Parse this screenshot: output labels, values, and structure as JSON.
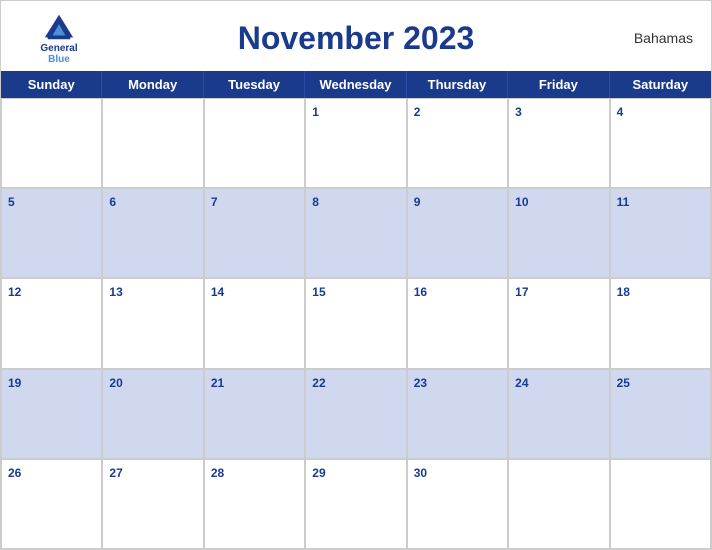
{
  "header": {
    "title": "November 2023",
    "country": "Bahamas",
    "logo_general": "General",
    "logo_blue": "Blue"
  },
  "days": [
    "Sunday",
    "Monday",
    "Tuesday",
    "Wednesday",
    "Thursday",
    "Friday",
    "Saturday"
  ],
  "weeks": [
    [
      "",
      "",
      "",
      "1",
      "2",
      "3",
      "4"
    ],
    [
      "5",
      "6",
      "7",
      "8",
      "9",
      "10",
      "11"
    ],
    [
      "12",
      "13",
      "14",
      "15",
      "16",
      "17",
      "18"
    ],
    [
      "19",
      "20",
      "21",
      "22",
      "23",
      "24",
      "25"
    ],
    [
      "26",
      "27",
      "28",
      "29",
      "30",
      "",
      ""
    ]
  ]
}
